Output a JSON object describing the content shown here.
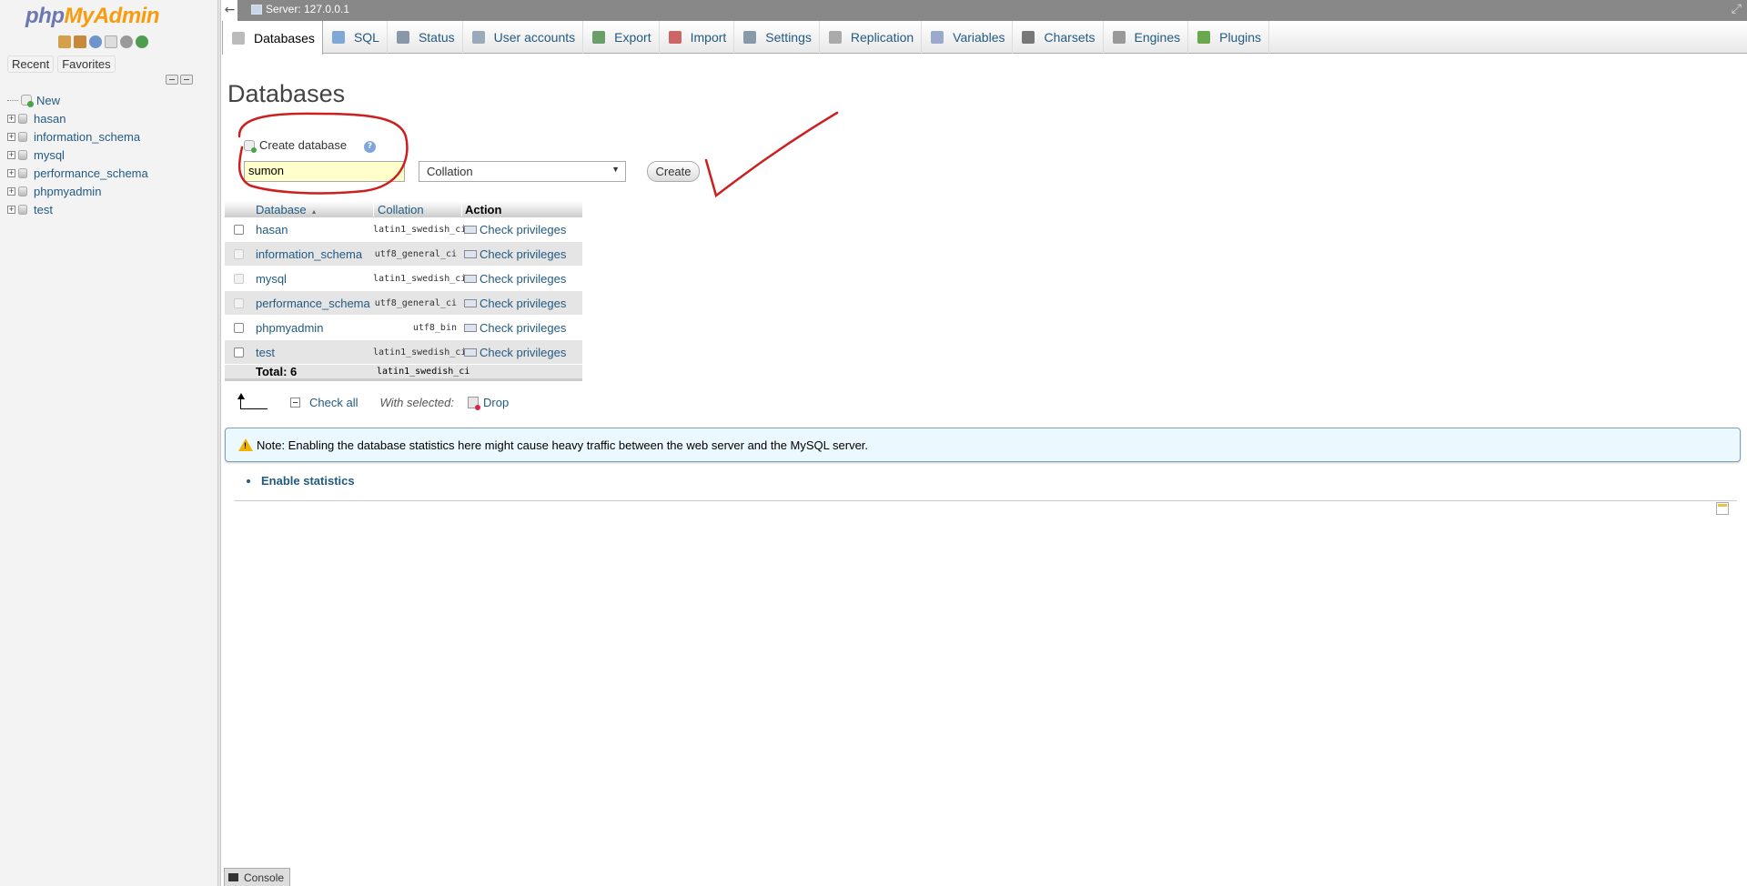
{
  "navigation": {
    "logo": {
      "part1": "php",
      "part2": "MyAdmin"
    },
    "icon_names": [
      "home-icon",
      "logout-icon",
      "help-icon",
      "docs-icon",
      "settings-icon",
      "reload-icon"
    ],
    "tabs": [
      "Recent",
      "Favorites"
    ],
    "tree": [
      {
        "label": "New",
        "kind": "new"
      },
      {
        "label": "hasan",
        "kind": "db"
      },
      {
        "label": "information_schema",
        "kind": "db"
      },
      {
        "label": "mysql",
        "kind": "db"
      },
      {
        "label": "performance_schema",
        "kind": "db"
      },
      {
        "label": "phpmyadmin",
        "kind": "db"
      },
      {
        "label": "test",
        "kind": "db"
      }
    ]
  },
  "serverbar": {
    "back": "←",
    "title": "Server: 127.0.0.1",
    "collapse": "⤢"
  },
  "menu": [
    {
      "label": "Databases",
      "icon": "database-icon",
      "color": "#bbbbbb",
      "active": true
    },
    {
      "label": "SQL",
      "icon": "sql-icon",
      "color": "#7fa8d6"
    },
    {
      "label": "Status",
      "icon": "status-icon",
      "color": "#8898a8"
    },
    {
      "label": "User accounts",
      "icon": "users-icon",
      "color": "#99aabb"
    },
    {
      "label": "Export",
      "icon": "export-icon",
      "color": "#6a9f6a"
    },
    {
      "label": "Import",
      "icon": "import-icon",
      "color": "#cc6666"
    },
    {
      "label": "Settings",
      "icon": "wrench-icon",
      "color": "#8899aa"
    },
    {
      "label": "Replication",
      "icon": "replication-icon",
      "color": "#aaaaaa"
    },
    {
      "label": "Variables",
      "icon": "variables-icon",
      "color": "#99aacc"
    },
    {
      "label": "Charsets",
      "icon": "charsets-icon",
      "color": "#777777"
    },
    {
      "label": "Engines",
      "icon": "engines-icon",
      "color": "#999999"
    },
    {
      "label": "Plugins",
      "icon": "plugins-icon",
      "color": "#6aa84f"
    }
  ],
  "main": {
    "title": "Databases",
    "create": {
      "label": "Create database",
      "help": "?",
      "name_value": "sumon",
      "collation_value": "Collation",
      "collation_arrow": "▼",
      "button": "Create"
    },
    "table": {
      "headers": {
        "database": "Database",
        "collation": "Collation",
        "action": "Action",
        "sort": "▲"
      },
      "rows": [
        {
          "name": "hasan",
          "collation": "latin1_swedish_ci",
          "action": "Check privileges",
          "disabled": false
        },
        {
          "name": "information_schema",
          "collation": "utf8_general_ci",
          "action": "Check privileges",
          "disabled": true
        },
        {
          "name": "mysql",
          "collation": "latin1_swedish_ci",
          "action": "Check privileges",
          "disabled": true
        },
        {
          "name": "performance_schema",
          "collation": "utf8_general_ci",
          "action": "Check privileges",
          "disabled": true
        },
        {
          "name": "phpmyadmin",
          "collation": "utf8_bin",
          "action": "Check privileges",
          "disabled": false
        },
        {
          "name": "test",
          "collation": "latin1_swedish_ci",
          "action": "Check privileges",
          "disabled": false
        }
      ],
      "total_label": "Total: 6",
      "total_collation": "latin1_swedish_ci"
    },
    "bulk": {
      "check_all": "Check all",
      "with_selected": "With selected:",
      "drop": "Drop"
    },
    "notice": "Note: Enabling the database statistics here might cause heavy traffic between the web server and the MySQL server.",
    "enable_stats": "Enable statistics"
  },
  "console": {
    "label": "Console"
  },
  "annotation_color": "#cc1f1f"
}
